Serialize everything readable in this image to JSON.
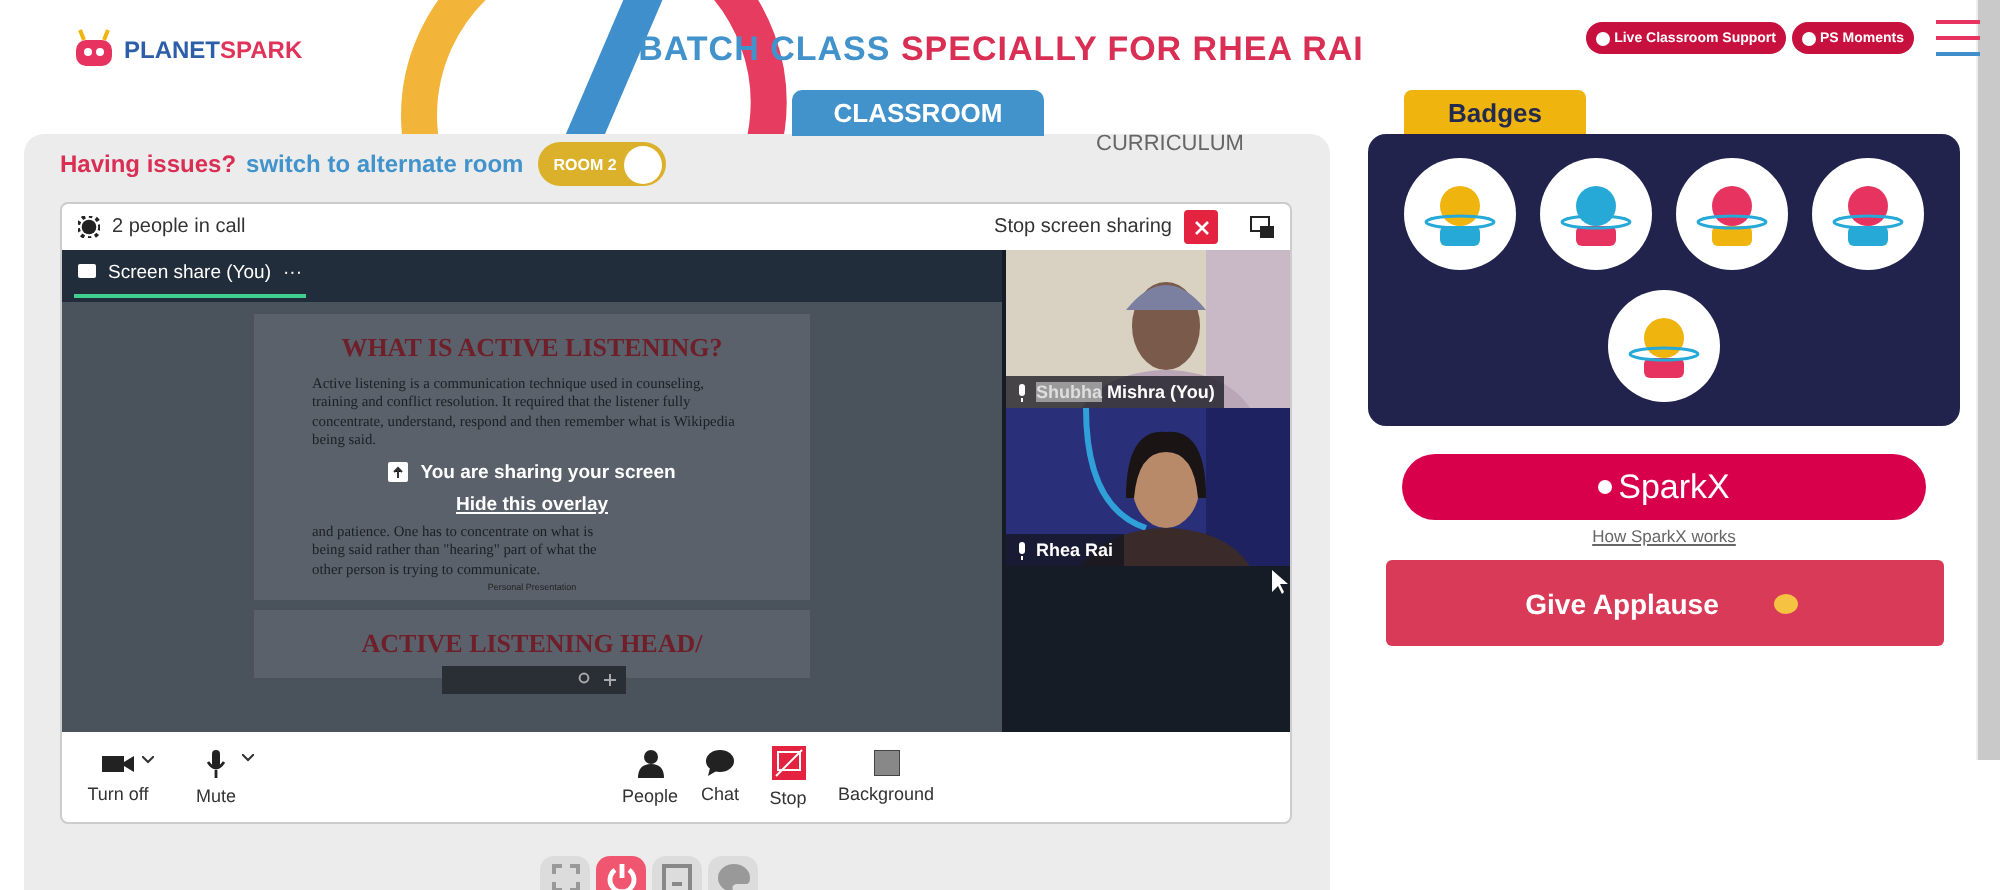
{
  "logo": {
    "part_a": "PLANET",
    "part_b": "SPARK"
  },
  "header": {
    "title_a": "BATCH CLASS",
    "title_b": "SPECIALLY FOR RHEA RAI",
    "buttons": [
      {
        "label": "Live Classroom Support"
      },
      {
        "label": "PS Moments"
      }
    ]
  },
  "tabs": [
    {
      "label": "CLASSROOM",
      "selected": true
    },
    {
      "label": "CURRICULUM",
      "selected": false
    }
  ],
  "issues": {
    "question": "Having issues?",
    "action": "switch to alternate room",
    "toggle": {
      "label": "ROOM 2",
      "on": true
    }
  },
  "call": {
    "people": "2 people in call",
    "stop_sharing": "Stop screen sharing",
    "share_tab": {
      "label": "Screen share (You)",
      "more": "···"
    },
    "slides": [
      {
        "title": "WHAT IS ACTIVE LISTENING?",
        "paragraphs": [
          "Active listening is a communication technique used in counseling, training and conflict resolution. It required that the listener fully concentrate, understand, respond and then remember what is Wikipedia being said."
        ],
        "tail": [
          "and patience. One has to concentrate on what is",
          "being said rather than \"hearing\" part of what the",
          "other person is trying to communicate."
        ],
        "footer": "Personal Presentation"
      },
      {
        "title": "ACTIVE LISTENING HEAD/"
      }
    ],
    "overlay": {
      "message": "You are sharing your screen",
      "hide": "Hide this overlay"
    },
    "participants": [
      {
        "selected_text": "Shubha",
        "name": "Mishra (You)"
      },
      {
        "name": "Rhea Rai"
      }
    ],
    "controls": [
      {
        "kind": "camera",
        "label": "Turn off",
        "menu": true,
        "active": false
      },
      {
        "kind": "mic",
        "label": "Mute",
        "menu": true,
        "active": false
      },
      {
        "kind": "people",
        "label": "People",
        "menu": false,
        "active": false
      },
      {
        "kind": "chat",
        "label": "Chat",
        "menu": false,
        "active": false
      },
      {
        "kind": "stop",
        "label": "Stop",
        "menu": false,
        "active": true
      },
      {
        "kind": "background",
        "label": "Background",
        "menu": false,
        "active": false
      }
    ]
  },
  "bottom_buttons": [
    {
      "kind": "fullscreen",
      "active": false
    },
    {
      "kind": "power",
      "active": true
    },
    {
      "kind": "screen",
      "active": false
    },
    {
      "kind": "palette",
      "active": false
    }
  ],
  "badges": {
    "title": "Badges",
    "items": [
      {
        "kind": "trophy"
      },
      {
        "kind": "fist"
      },
      {
        "kind": "wizard"
      },
      {
        "kind": "speaker"
      },
      {
        "kind": "brain"
      }
    ]
  },
  "sparkx": {
    "label": "SparkX",
    "link": "How SparkX works"
  },
  "applause": {
    "label": "Give Applause"
  }
}
